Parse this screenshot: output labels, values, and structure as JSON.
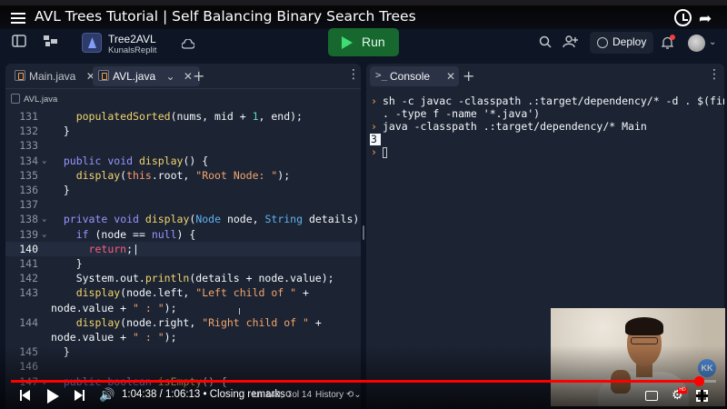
{
  "video": {
    "title": "AVL Trees Tutorial | Self Balancing Binary Search Trees",
    "time": "1:04:38 / 1:06:13",
    "chapter": "• Closing remarks ›",
    "progress": 0.976
  },
  "header": {
    "repl_name": "Tree2AVL",
    "owner": "KunalsReplit",
    "run_label": "Run",
    "deploy_label": "Deploy",
    "icons": [
      "sidebar-toggle-icon",
      "files-icon",
      "cloud-icon",
      "search-icon",
      "invite-icon",
      "bell-icon"
    ]
  },
  "editor": {
    "tabs": [
      {
        "label": "Main.java",
        "active": false
      },
      {
        "label": "AVL.java",
        "active": true
      }
    ],
    "breadcrumb": "AVL.java",
    "lines": [
      {
        "no": "131",
        "fold": false,
        "html": "    <span class='f'>populatedSorted</span>(nums, mid + <span class='n'>1</span>, end);"
      },
      {
        "no": "132",
        "fold": false,
        "html": "  }"
      },
      {
        "no": "133",
        "fold": false,
        "html": ""
      },
      {
        "no": "134",
        "fold": true,
        "html": "  <span class='k'>public</span> <span class='k'>void</span> <span class='f'>display</span>() {"
      },
      {
        "no": "135",
        "fold": false,
        "html": "    <span class='f'>display</span>(<span class='ti'>this</span>.root, <span class='s'>\"Root Node: \"</span>);"
      },
      {
        "no": "136",
        "fold": false,
        "html": "  }"
      },
      {
        "no": "137",
        "fold": false,
        "html": ""
      },
      {
        "no": "138",
        "fold": true,
        "html": "  <span class='k'>private</span> <span class='k'>void</span> <span class='f'>display</span>(<span class='t'>Node</span> node, <span class='t'>String</span> details) {"
      },
      {
        "no": "139",
        "fold": true,
        "html": "    <span class='k'>if</span> (node == <span class='k'>null</span>) {"
      },
      {
        "no": "140",
        "fold": false,
        "html": "      <span class='kw'>return</span>;|",
        "current": true
      },
      {
        "no": "141",
        "fold": false,
        "html": "    }"
      },
      {
        "no": "142",
        "fold": false,
        "html": "    System.out.<span class='f'>println</span>(details + node.value);"
      },
      {
        "no": "143",
        "fold": false,
        "html": "    <span class='f'>display</span>(node.left, <span class='s'>\"Left child of \"</span> +"
      },
      {
        "no": "",
        "fold": false,
        "html": "node.value + <span class='s'>\" : \"</span>);",
        "wrap": true
      },
      {
        "no": "144",
        "fold": false,
        "html": "    <span class='f'>display</span>(node.right, <span class='s'>\"Right child of \"</span> +"
      },
      {
        "no": "",
        "fold": false,
        "html": "node.value + <span class='s'>\" : \"</span>);",
        "wrap": true
      },
      {
        "no": "145",
        "fold": false,
        "html": "  }"
      },
      {
        "no": "146",
        "fold": false,
        "html": ""
      },
      {
        "no": "147",
        "fold": true,
        "html": "  <span class='k'>public</span> <span class='k'>boolean</span> <span class='f'>isEmpty</span>() {"
      }
    ]
  },
  "console": {
    "tab_label": "Console",
    "lines": [
      {
        "text": "sh -c javac -classpath .:target/dependency/* -d . $(find",
        "chevron": true
      },
      {
        "text": ". -type f -name '*.java')",
        "chevron": false
      },
      {
        "text": "java -classpath .:target/dependency/* Main",
        "chevron": true
      }
    ],
    "output": "3"
  },
  "status": {
    "position": "Ln 140, Col 14",
    "history": "History"
  }
}
